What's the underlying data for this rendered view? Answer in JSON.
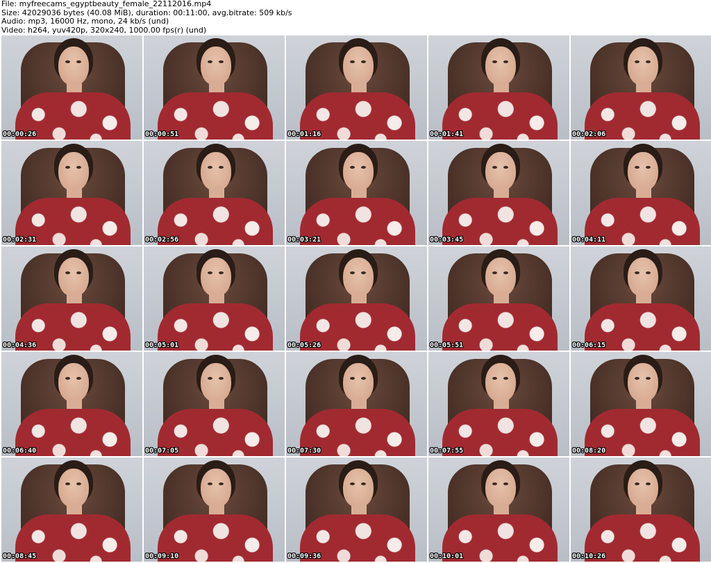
{
  "header": {
    "file_line": "File: myfreecams_egyptbeauty_female_22112016.mp4",
    "size_line": "Size: 42029036 bytes (40.08 MiB), duration: 00:11:00, avg.bitrate: 509 kb/s",
    "audio_line": "Audio: mp3, 16000 Hz, mono, 24 kb/s (und)",
    "video_line": "Video: h264, yuv420p, 320x240, 1000.00 fps(r) (und)"
  },
  "thumbnails": [
    {
      "timestamp": "00:00:26"
    },
    {
      "timestamp": "00:00:51"
    },
    {
      "timestamp": "00:01:16"
    },
    {
      "timestamp": "00:01:41"
    },
    {
      "timestamp": "00:02:06"
    },
    {
      "timestamp": "00:02:31"
    },
    {
      "timestamp": "00:02:56"
    },
    {
      "timestamp": "00:03:21"
    },
    {
      "timestamp": "00:03:45"
    },
    {
      "timestamp": "00:04:11"
    },
    {
      "timestamp": "00:04:36"
    },
    {
      "timestamp": "00:05:01"
    },
    {
      "timestamp": "00:05:26"
    },
    {
      "timestamp": "00:05:51"
    },
    {
      "timestamp": "00:06:15"
    },
    {
      "timestamp": "00:06:40"
    },
    {
      "timestamp": "00:07:05"
    },
    {
      "timestamp": "00:07:30"
    },
    {
      "timestamp": "00:07:55"
    },
    {
      "timestamp": "00:08:20"
    },
    {
      "timestamp": "00:08:45"
    },
    {
      "timestamp": "00:09:10"
    },
    {
      "timestamp": "00:09:36"
    },
    {
      "timestamp": "00:10:01"
    },
    {
      "timestamp": "00:10:26"
    }
  ],
  "colors": {
    "background": "#ffffff",
    "timestamp_text": "#ffffff",
    "timestamp_outline": "#000000",
    "dress_red": "#a12a31",
    "chair_brown": "#4e342a",
    "wall_gray": "#c7ccd4"
  }
}
